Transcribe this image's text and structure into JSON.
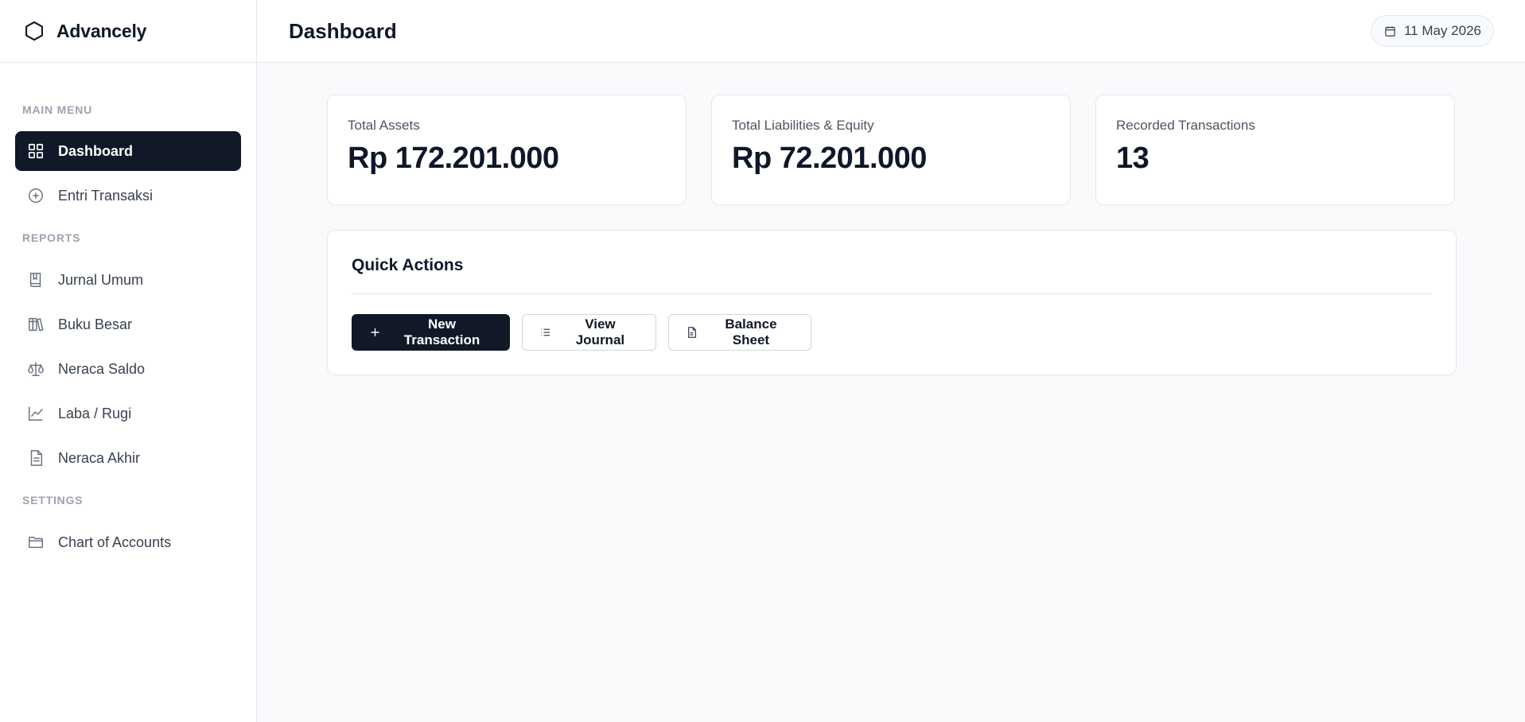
{
  "brand": {
    "name": "Advancely",
    "icon": "hexagon-logo-icon"
  },
  "header": {
    "title": "Dashboard",
    "date": "11 May 2026",
    "date_icon": "calendar-icon"
  },
  "sidebar": {
    "sections": [
      {
        "title": "MAIN MENU"
      },
      {
        "title": "REPORTS"
      },
      {
        "title": "SETTINGS"
      }
    ],
    "items": [
      {
        "label": "Dashboard",
        "icon": "grid-icon",
        "active": true
      },
      {
        "label": "Entri Transaksi",
        "icon": "plus-circle-icon"
      },
      {
        "label": "Jurnal Umum",
        "icon": "book-icon"
      },
      {
        "label": "Buku Besar",
        "icon": "library-icon"
      },
      {
        "label": "Neraca Saldo",
        "icon": "scale-icon"
      },
      {
        "label": "Laba / Rugi",
        "icon": "trending-up-icon"
      },
      {
        "label": "Neraca Akhir",
        "icon": "file-text-icon"
      },
      {
        "label": "Chart of Accounts",
        "icon": "folder-icon"
      }
    ]
  },
  "stats": [
    {
      "label": "Total Assets",
      "value": "Rp 172.201.000"
    },
    {
      "label": "Total Liabilities & Equity",
      "value": "Rp 72.201.000"
    },
    {
      "label": "Recorded Transactions",
      "value": "13"
    }
  ],
  "quick_actions": {
    "title": "Quick Actions",
    "buttons": [
      {
        "label": "New Transaction",
        "icon": "plus-icon"
      },
      {
        "label": "View Journal",
        "icon": "list-icon"
      },
      {
        "label": "Balance Sheet",
        "icon": "file-icon"
      }
    ]
  },
  "colors": {
    "primary": "#111827",
    "background": "#f8fafc",
    "border": "#e5e7eb",
    "muted_text": "#9ca3af"
  }
}
